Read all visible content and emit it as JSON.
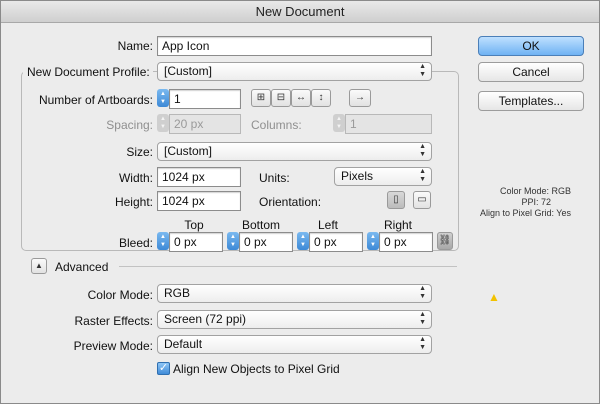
{
  "window": {
    "title": "New Document"
  },
  "name": {
    "label": "Name:",
    "value": "App Icon"
  },
  "profile": {
    "label": "New Document Profile:",
    "value": "[Custom]"
  },
  "artboards": {
    "label": "Number of Artboards:",
    "value": "1"
  },
  "spacing": {
    "label": "Spacing:",
    "value": "20 px"
  },
  "columns": {
    "label": "Columns:",
    "value": "1"
  },
  "size": {
    "label": "Size:",
    "value": "[Custom]"
  },
  "width": {
    "label": "Width:",
    "value": "1024 px"
  },
  "height": {
    "label": "Height:",
    "value": "1024 px"
  },
  "units": {
    "label": "Units:",
    "value": "Pixels"
  },
  "orientation": {
    "label": "Orientation:"
  },
  "bleed": {
    "label": "Bleed:",
    "top_label": "Top",
    "bottom_label": "Bottom",
    "left_label": "Left",
    "right_label": "Right",
    "top": "0 px",
    "bottom": "0 px",
    "left": "0 px",
    "right": "0 px"
  },
  "advanced": {
    "label": "Advanced"
  },
  "color_mode": {
    "label": "Color Mode:",
    "value": "RGB"
  },
  "raster": {
    "label": "Raster Effects:",
    "value": "Screen (72 ppi)"
  },
  "preview": {
    "label": "Preview Mode:",
    "value": "Default"
  },
  "align": {
    "label": "Align New Objects to Pixel Grid",
    "checked": true
  },
  "buttons": {
    "ok": "OK",
    "cancel": "Cancel",
    "templates": "Templates..."
  },
  "summary": {
    "line1": "Color Mode: RGB",
    "line2": "PPI: 72",
    "line3": "Align to Pixel Grid: Yes"
  },
  "icons": {
    "grid_row": "grid-by-row-icon",
    "grid_col": "grid-by-column-icon",
    "arrange_row": "arrange-by-row-icon",
    "arrange_col": "arrange-by-column-icon",
    "direction": "right-to-left-layout-icon",
    "portrait": "portrait-icon",
    "landscape": "landscape-icon",
    "link": "link-bleed-icon",
    "warning": "warning-icon"
  },
  "colors": {
    "accent": "#4a90e2",
    "warning": "#f2c200"
  }
}
